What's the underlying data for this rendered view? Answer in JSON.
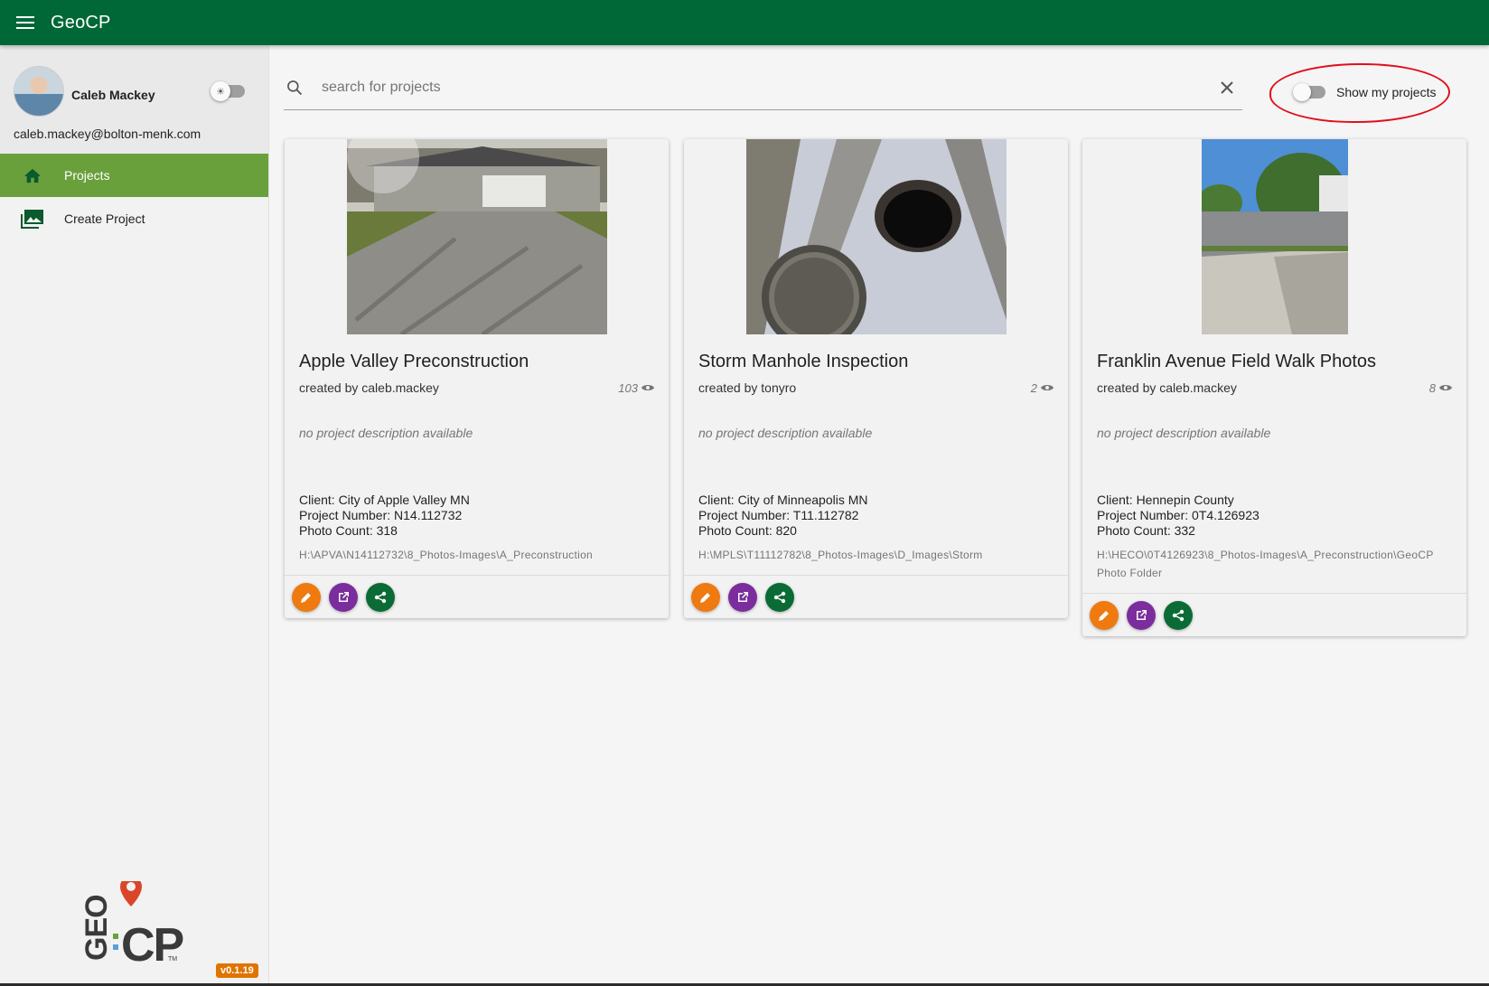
{
  "app": {
    "title": "GeoCP"
  },
  "user": {
    "name": "Caleb Mackey",
    "email": "caleb.mackey@bolton-menk.com"
  },
  "nav": [
    {
      "label": "Projects",
      "icon": "home-icon",
      "active": true
    },
    {
      "label": "Create Project",
      "icon": "photo-library-icon",
      "active": false
    }
  ],
  "search": {
    "placeholder": "search for projects",
    "value": ""
  },
  "filter": {
    "show_mine_label": "Show my projects",
    "show_mine_on": false
  },
  "projects": [
    {
      "title": "Apple Valley Preconstruction",
      "created_by": "created by caleb.mackey",
      "views": "103",
      "description": "no project description available",
      "client": "Client: City of Apple Valley MN",
      "project_number": "Project Number: N14.112732",
      "photo_count": "Photo Count: 318",
      "path": "H:\\APVA\\N14112732\\8_Photos-Images\\A_Preconstruction"
    },
    {
      "title": "Storm Manhole Inspection",
      "created_by": "created by tonyro",
      "views": "2",
      "description": "no project description available",
      "client": "Client: City of Minneapolis MN",
      "project_number": "Project Number: T11.112782",
      "photo_count": "Photo Count: 820",
      "path": "H:\\MPLS\\T11112782\\8_Photos-Images\\D_Images\\Storm"
    },
    {
      "title": "Franklin Avenue Field Walk Photos",
      "created_by": "created by caleb.mackey",
      "views": "8",
      "description": "no project description available",
      "client": "Client: Hennepin County",
      "project_number": "Project Number: 0T4.126923",
      "photo_count": "Photo Count: 332",
      "path": "H:\\HECO\\0T4126923\\8_Photos-Images\\A_Preconstruction\\GeoCP Photo Folder"
    }
  ],
  "brand": {
    "logo_text": "GEO:CP",
    "tm": "TM",
    "version": "v0.1.19"
  },
  "colors": {
    "appbar": "#006837",
    "nav_active": "#6aa03c",
    "edit": "#ee7a10",
    "open": "#7b2d9e",
    "share": "#0a6b35",
    "version_badge": "#e07400"
  }
}
